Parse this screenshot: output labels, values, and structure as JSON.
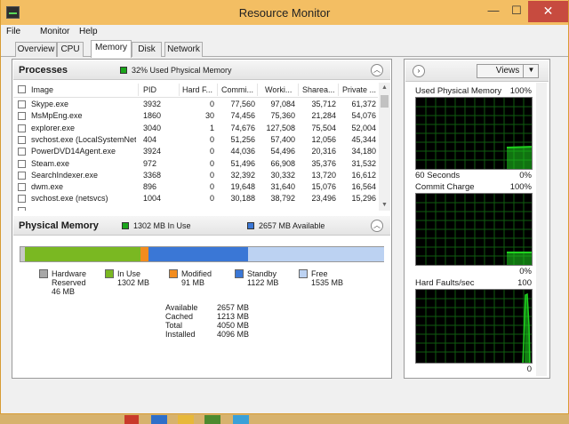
{
  "window": {
    "title": "Resource Monitor",
    "minimize": "—",
    "maximize": "☐",
    "close": "✕"
  },
  "menu": [
    "File",
    "Monitor",
    "Help"
  ],
  "tabs": [
    "Overview",
    "CPU",
    "Memory",
    "Disk",
    "Network"
  ],
  "active_tab": "Memory",
  "processes": {
    "title": "Processes",
    "used_text": "32% Used Physical Memory",
    "used_swatch_color": "#1aa51a",
    "columns": [
      "Image",
      "PID",
      "Hard F...",
      "Commi...",
      "Worki...",
      "Sharea...",
      "Private ..."
    ],
    "rows": [
      [
        "Skype.exe",
        "3932",
        "0",
        "77,560",
        "97,084",
        "35,712",
        "61,372"
      ],
      [
        "MsMpEng.exe",
        "1860",
        "30",
        "74,456",
        "75,360",
        "21,284",
        "54,076"
      ],
      [
        "explorer.exe",
        "3040",
        "1",
        "74,676",
        "127,508",
        "75,504",
        "52,004"
      ],
      [
        "svchost.exe (LocalSystemNet...",
        "404",
        "0",
        "51,256",
        "57,400",
        "12,056",
        "45,344"
      ],
      [
        "PowerDVD14Agent.exe",
        "3924",
        "0",
        "44,036",
        "54,496",
        "20,316",
        "34,180"
      ],
      [
        "Steam.exe",
        "972",
        "0",
        "51,496",
        "66,908",
        "35,376",
        "31,532"
      ],
      [
        "SearchIndexer.exe",
        "3368",
        "0",
        "32,392",
        "30,332",
        "13,720",
        "16,612"
      ],
      [
        "dwm.exe",
        "896",
        "0",
        "19,648",
        "31,640",
        "15,076",
        "16,564"
      ],
      [
        "svchost.exe (netsvcs)",
        "1004",
        "0",
        "30,188",
        "38,792",
        "23,496",
        "15,296"
      ],
      [
        "...",
        "",
        "",
        "",
        "",
        "",
        ""
      ]
    ]
  },
  "physical_memory": {
    "title": "Physical Memory",
    "in_use_text": "1302 MB In Use",
    "available_text": "2657 MB Available",
    "in_use_color": "#1aa51a",
    "available_color": "#3a77d6",
    "bar": [
      {
        "name": "Hardware Reserved",
        "mb": 46,
        "color": "#c8c8c8"
      },
      {
        "name": "In Use",
        "mb": 1302,
        "color": "#7ab822"
      },
      {
        "name": "Modified",
        "mb": 91,
        "color": "#f28c1e"
      },
      {
        "name": "Standby",
        "mb": 1122,
        "color": "#3a77d6"
      },
      {
        "name": "Free",
        "mb": 1535,
        "color": "#bcd2f2"
      }
    ],
    "legend": [
      {
        "line1": "Hardware",
        "line2": "Reserved",
        "line3": "46 MB",
        "color": "#a8a8a8"
      },
      {
        "line1": "In Use",
        "line2": "1302 MB",
        "line3": "",
        "color": "#7ab822"
      },
      {
        "line1": "Modified",
        "line2": "91 MB",
        "line3": "",
        "color": "#f28c1e"
      },
      {
        "line1": "Standby",
        "line2": "1122 MB",
        "line3": "",
        "color": "#3a77d6"
      },
      {
        "line1": "Free",
        "line2": "1535 MB",
        "line3": "",
        "color": "#bcd2f2"
      }
    ],
    "stats": [
      {
        "label": "Available",
        "value": "2657 MB"
      },
      {
        "label": "Cached",
        "value": "1213 MB"
      },
      {
        "label": "Total",
        "value": "4050 MB"
      },
      {
        "label": "Installed",
        "value": "4096 MB"
      }
    ]
  },
  "graphs_panel": {
    "views_label": "Views",
    "graphs": [
      {
        "title": "Used Physical Memory",
        "max": "100%",
        "footer_left": "60 Seconds",
        "footer_right": "0%"
      },
      {
        "title": "Commit Charge",
        "max": "100%",
        "footer_left": "",
        "footer_right": "0%"
      },
      {
        "title": "Hard Faults/sec",
        "max": "100",
        "footer_left": "",
        "footer_right": "0"
      }
    ]
  },
  "colors": {
    "titlebar": "#f3be63",
    "close": "#c74b3f",
    "graph_line": "#1fd21f",
    "graph_grid": "#0f5c0f"
  }
}
